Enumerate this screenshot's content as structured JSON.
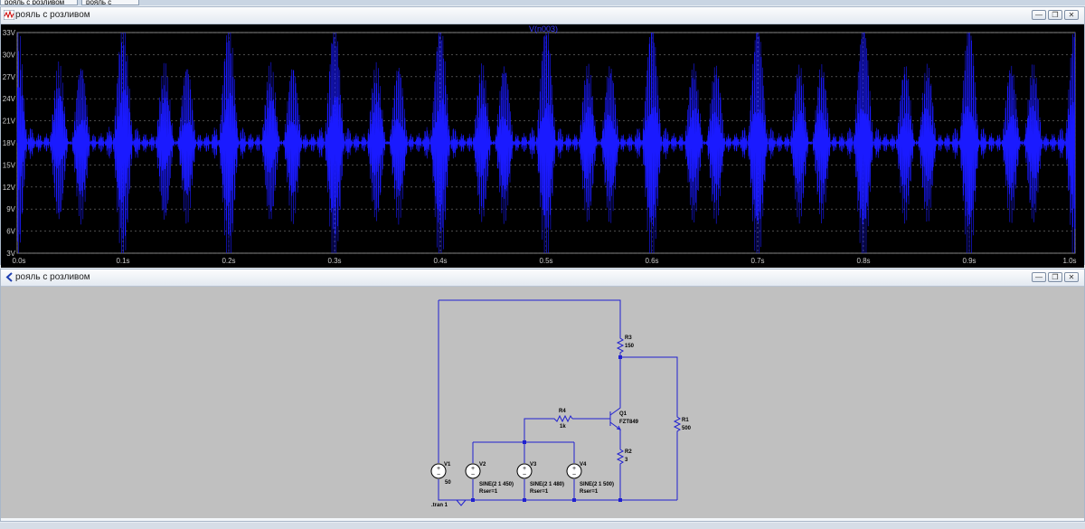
{
  "tabs": [
    {
      "label": "рояль с розливом"
    },
    {
      "label": "рояль с розливом"
    }
  ],
  "plot_window": {
    "title": "рояль с розливом",
    "buttons": {
      "minimize": "—",
      "restore": "❐",
      "close": "✕"
    }
  },
  "schematic_window": {
    "title": "рояль с розливом",
    "buttons": {
      "minimize": "—",
      "restore": "❐",
      "close": "✕"
    }
  },
  "chart_data": {
    "type": "line",
    "title": "V(n003)",
    "xlabel": "",
    "ylabel": "",
    "xlim": [
      0,
      1.0
    ],
    "ylim": [
      3,
      33
    ],
    "x_ticks": [
      "0.0s",
      "0.1s",
      "0.2s",
      "0.3s",
      "0.4s",
      "0.5s",
      "0.6s",
      "0.7s",
      "0.8s",
      "0.9s",
      "1.0s"
    ],
    "y_ticks": [
      "3V",
      "6V",
      "9V",
      "12V",
      "15V",
      "18V",
      "21V",
      "24V",
      "27V",
      "30V",
      "33V"
    ],
    "grid": true,
    "series": [
      {
        "name": "V(n003)",
        "color": "#1a1aff",
        "signal": "sum of three sines (450 Hz, 480 Hz, 500 Hz) around 18V DC, envelope beating between ~3V and ~32V"
      }
    ]
  },
  "schematic": {
    "components": [
      {
        "ref": "V1",
        "value": "50"
      },
      {
        "ref": "V2",
        "value": "SINE(2 1 450)",
        "extra": "Rser=1"
      },
      {
        "ref": "V3",
        "value": "SINE(2 1 480)",
        "extra": "Rser=1"
      },
      {
        "ref": "V4",
        "value": "SINE(2 1 500)",
        "extra": "Rser=1"
      },
      {
        "ref": "R4",
        "value": "1k"
      },
      {
        "ref": "Q1",
        "value": "FZT849"
      },
      {
        "ref": "R3",
        "value": "150"
      },
      {
        "ref": "R2",
        "value": "3"
      },
      {
        "ref": "R1",
        "value": "500"
      }
    ],
    "directive": ".tran 1"
  }
}
